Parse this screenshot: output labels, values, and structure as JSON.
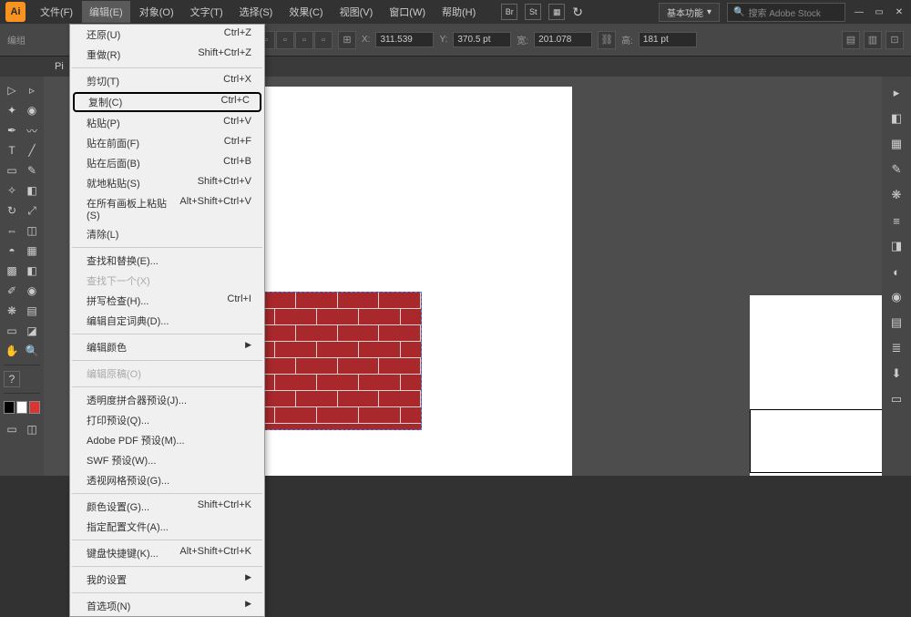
{
  "topbar": {
    "logo": "Ai",
    "menus": [
      "文件(F)",
      "编辑(E)",
      "对象(O)",
      "文字(T)",
      "选择(S)",
      "效果(C)",
      "视图(V)",
      "窗口(W)",
      "帮助(H)"
    ],
    "workspace_label": "基本功能",
    "search_placeholder": "搜索 Adobe Stock"
  },
  "controlbar": {
    "label": "编组",
    "x_label": "X:",
    "x_value": "311.539",
    "y_label": "Y:",
    "y_value": "370.5 pt",
    "w_label": "宽:",
    "w_value": "201.078",
    "h_label": "高:",
    "h_value": "181 pt"
  },
  "tabbar": {
    "tab_prefix": "Pi"
  },
  "dropdown": [
    {
      "label": "还原(U)",
      "shortcut": "Ctrl+Z"
    },
    {
      "label": "重做(R)",
      "shortcut": "Shift+Ctrl+Z"
    },
    {
      "sep": true
    },
    {
      "label": "剪切(T)",
      "shortcut": "Ctrl+X"
    },
    {
      "label": "复制(C)",
      "shortcut": "Ctrl+C",
      "highlighted": true
    },
    {
      "label": "粘贴(P)",
      "shortcut": "Ctrl+V"
    },
    {
      "label": "贴在前面(F)",
      "shortcut": "Ctrl+F"
    },
    {
      "label": "贴在后面(B)",
      "shortcut": "Ctrl+B"
    },
    {
      "label": "就地粘贴(S)",
      "shortcut": "Shift+Ctrl+V"
    },
    {
      "label": "在所有画板上粘贴(S)",
      "shortcut": "Alt+Shift+Ctrl+V"
    },
    {
      "label": "清除(L)",
      "shortcut": ""
    },
    {
      "sep": true
    },
    {
      "label": "查找和替换(E)...",
      "shortcut": ""
    },
    {
      "label": "查找下一个(X)",
      "shortcut": "",
      "disabled": true
    },
    {
      "label": "拼写检查(H)...",
      "shortcut": "Ctrl+I"
    },
    {
      "label": "编辑自定词典(D)...",
      "shortcut": ""
    },
    {
      "sep": true
    },
    {
      "label": "编辑颜色",
      "shortcut": "",
      "submenu": true
    },
    {
      "sep": true
    },
    {
      "label": "编辑原稿(O)",
      "shortcut": "",
      "disabled": true
    },
    {
      "sep": true
    },
    {
      "label": "透明度拼合器预设(J)...",
      "shortcut": ""
    },
    {
      "label": "打印预设(Q)...",
      "shortcut": ""
    },
    {
      "label": "Adobe PDF 预设(M)...",
      "shortcut": ""
    },
    {
      "label": "SWF 预设(W)...",
      "shortcut": ""
    },
    {
      "label": "透视网格预设(G)...",
      "shortcut": ""
    },
    {
      "sep": true
    },
    {
      "label": "颜色设置(G)...",
      "shortcut": "Shift+Ctrl+K"
    },
    {
      "label": "指定配置文件(A)...",
      "shortcut": ""
    },
    {
      "sep": true
    },
    {
      "label": "键盘快捷键(K)...",
      "shortcut": "Alt+Shift+Ctrl+K"
    },
    {
      "sep": true
    },
    {
      "label": "我的设置",
      "shortcut": "",
      "submenu": true
    },
    {
      "sep": true
    },
    {
      "label": "首选项(N)",
      "shortcut": "",
      "submenu": true
    }
  ]
}
